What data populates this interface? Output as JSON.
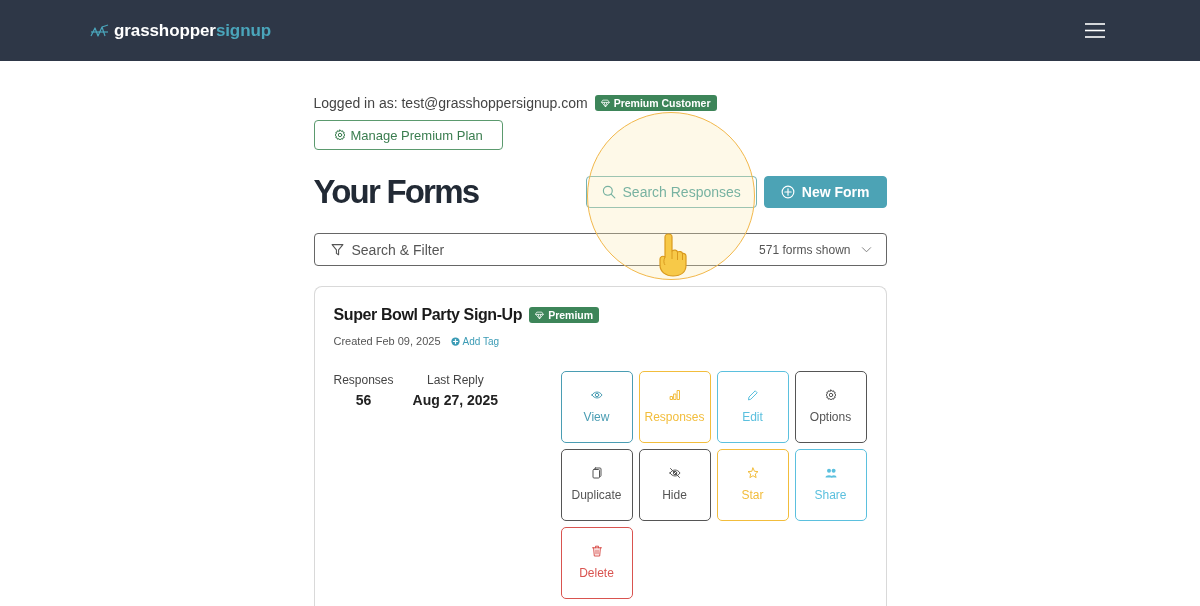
{
  "header": {
    "brand": {
      "part_1": "grasshopper",
      "part_2": "signup"
    }
  },
  "account": {
    "logged_in": "Logged in as: test@grasshoppersignup.com",
    "badge": "Premium Customer",
    "manage_button": "Manage Premium Plan"
  },
  "heading": "Your Forms",
  "toolbar": {
    "buttons": [
      {
        "label": "Search Responses",
        "kind": "search",
        "highlighted": true
      },
      {
        "label": "New Form",
        "kind": "new",
        "highlighted": false
      }
    ]
  },
  "filter": {
    "placeholder": "Search & Filter",
    "count": "571 forms shown"
  },
  "forms": [
    {
      "title": "Super Bowl Party Sign-Up",
      "badge": "Premium",
      "created": "Created Feb 09, 2025",
      "add_tag": "Add Tag",
      "stats": [
        {
          "label": "Responses",
          "value": "56"
        },
        {
          "label": "Last Reply",
          "value": "Aug 27, 2025"
        }
      ],
      "actions": [
        {
          "label": "View",
          "kind": "view",
          "color": "#4a9db3"
        },
        {
          "label": "Responses",
          "kind": "responses",
          "color": "#f2bd3c"
        },
        {
          "label": "Edit",
          "kind": "edit",
          "color": "#5bc0de"
        },
        {
          "label": "Options",
          "kind": "options",
          "color": "#555555"
        },
        {
          "label": "Duplicate",
          "kind": "duplicate",
          "color": "#555555"
        },
        {
          "label": "Hide",
          "kind": "hide",
          "color": "#555555"
        },
        {
          "label": "Star",
          "kind": "star",
          "color": "#f2bd3c"
        },
        {
          "label": "Share",
          "kind": "share",
          "color": "#5bc0de"
        },
        {
          "label": "Delete",
          "kind": "delete",
          "color": "#d9534f"
        }
      ]
    }
  ]
}
